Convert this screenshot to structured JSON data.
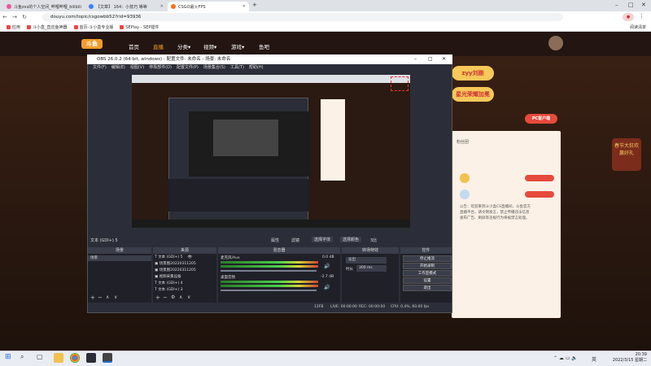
{
  "browser": {
    "tabs": [
      {
        "label": "斗鱼zxs的个人空间_哔哩哔哩_bilibili",
        "fav": "#ee5599"
      },
      {
        "label": "【文章】 164：小技巧 等等",
        "fav": "#3b82f6"
      },
      {
        "label": "CSGO最火FPS",
        "fav": "#f97316"
      }
    ],
    "new_tab": "+",
    "url": "douyu.com/topic/csgowbb52?rid=93936",
    "bookmarks": [
      "应用",
      "斗小盒_直应鱼神器",
      "首页-斗小盒专业版",
      "SEPlay - SEP插件"
    ],
    "reading_list": "阅读清单"
  },
  "site": {
    "nav": [
      "首页",
      "直播",
      "分类▾",
      "视频▾",
      "游戏▾",
      "鱼吧"
    ],
    "promo_buttons": [
      "zyy刘刚",
      "星光荣耀加冕",
      "PC客户端"
    ],
    "notice_lines": [
      "公告：欢迎来到斗小盒CS直播间，斗鱼官方",
      "直播平台，请文明发言，禁止传播违法信息",
      "发布广告、刷屏等违规行为将被禁言处理。"
    ],
    "fans": [
      "粉丝团",
      "CSGO",
      "粉丝大咖"
    ],
    "right_promo": [
      "春节大狂欢",
      "赢好礼",
      "活动详情"
    ]
  },
  "obs": {
    "title": "OBS 26.0.2 (64-bit, windows) - 配置文件: 未命名 - 场景: 未命名",
    "menu": [
      "文件(F)",
      "编辑(E)",
      "视图(V)",
      "停靠部件(D)",
      "配置文件(P)",
      "场景集合(S)",
      "工具(T)",
      "帮助(H)"
    ],
    "source_bar": {
      "label": "文本 (GDI+) 5",
      "tabs": [
        "属性",
        "滤镜",
        "选择字体",
        "选择颜色"
      ],
      "ratio": "3比"
    },
    "docks": [
      "场景",
      "来源",
      "混音器",
      "转场特效",
      "控件"
    ],
    "scene": "场景",
    "sources": [
      "文本 (GDI+) 5",
      "场景图20220311205",
      "场景图20220311205",
      "视频采集设备",
      "文本 (GDI+) 4",
      "文本 (GDI+) 3"
    ],
    "mixer": [
      {
        "name": "麦克风/Aux",
        "db": "0.0 dB"
      },
      {
        "name": "桌面音频",
        "db": "-2.7 dB"
      }
    ],
    "transition": {
      "name": "淡出",
      "duration_label": "时长",
      "duration": "300 ms"
    },
    "controls": [
      "停止推流",
      "开始录制",
      "工作室模式",
      "设置",
      "退出"
    ],
    "status": {
      "live": "LIVE: 00:00:00",
      "rec": "REC: 00:00:00",
      "cpu": "CPU: 0.4%, 60.00 fps",
      "kbps": "12FB"
    }
  },
  "taskbar": {
    "time": "20:39",
    "date": "2022/3/15 星期二",
    "lang": "英"
  }
}
